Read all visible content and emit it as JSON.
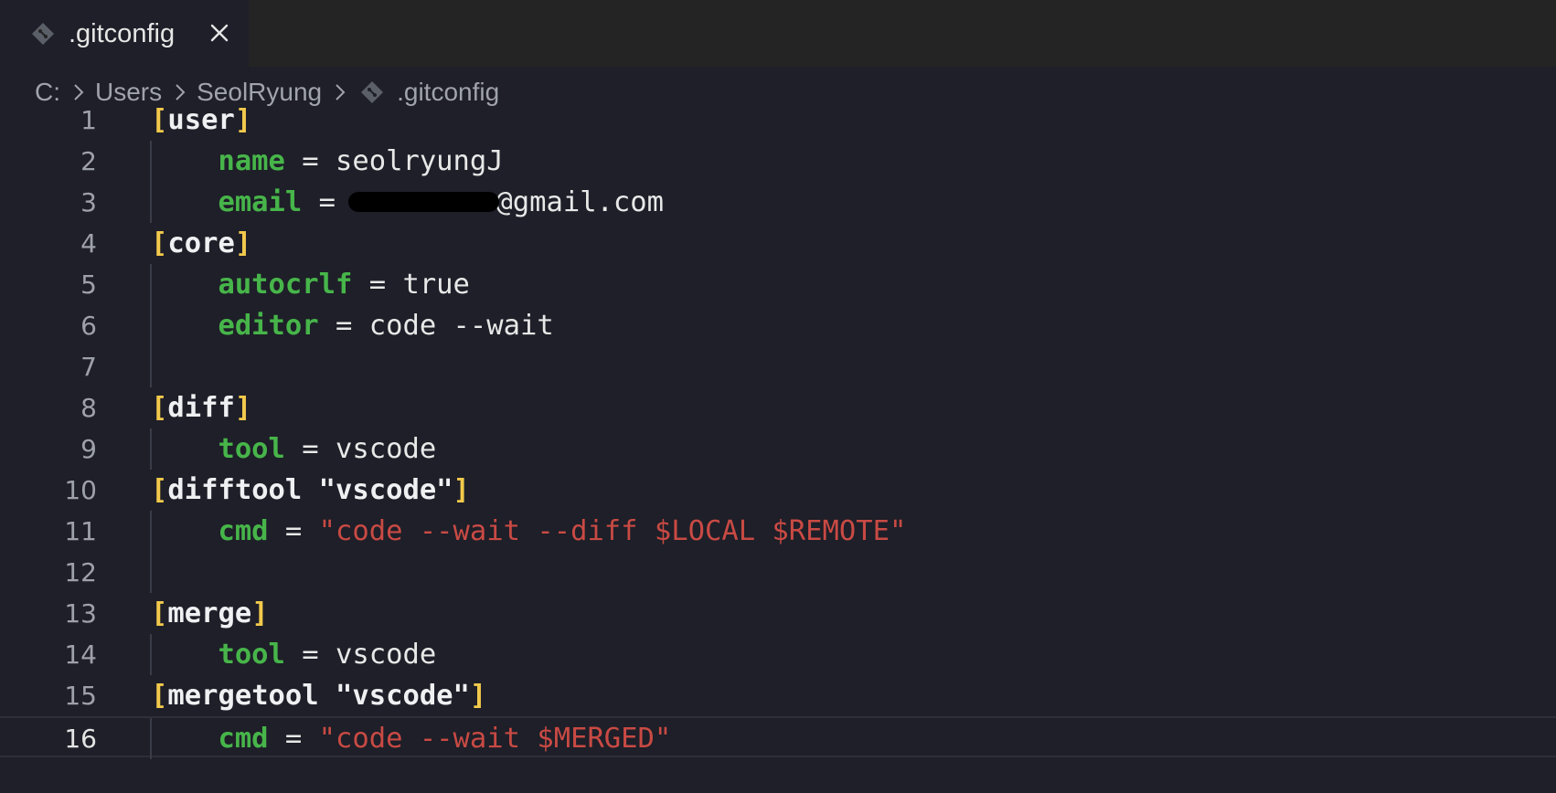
{
  "colors": {
    "background": "#1e1f28",
    "tabbar": "#242424",
    "bracket": "#f2c94c",
    "key": "#47b54a",
    "string": "#c94a44",
    "text": "#e8e8e8"
  },
  "tab": {
    "title": ".gitconfig",
    "icon": "git-file-icon",
    "close_icon": "close-icon"
  },
  "breadcrumb": {
    "items": [
      "C:",
      "Users",
      "SeolRyung",
      ".gitconfig"
    ],
    "separator_icon": "chevron-right-icon",
    "file_icon": "git-file-icon"
  },
  "editor": {
    "current_line": 16,
    "lines": [
      {
        "num": "1",
        "bracket_open": "[",
        "section": "user",
        "bracket_close": "]"
      },
      {
        "num": "2",
        "indent": "    ",
        "key": "name",
        "op": " = ",
        "value": "seolryungJ"
      },
      {
        "num": "3",
        "indent": "    ",
        "key": "email",
        "op": " = ",
        "value": "@gmail.com"
      },
      {
        "num": "4",
        "bracket_open": "[",
        "section": "core",
        "bracket_close": "]"
      },
      {
        "num": "5",
        "indent": "    ",
        "key": "autocrlf",
        "op": " = ",
        "value": "true"
      },
      {
        "num": "6",
        "indent": "    ",
        "key": "editor",
        "op": " = ",
        "value": "code --wait"
      },
      {
        "num": "7"
      },
      {
        "num": "8",
        "bracket_open": "[",
        "section": "diff",
        "bracket_close": "]"
      },
      {
        "num": "9",
        "indent": "    ",
        "key": "tool",
        "op": " = ",
        "value": "vscode"
      },
      {
        "num": "10",
        "bracket_open": "[",
        "section": "difftool \"vscode\"",
        "bracket_close": "]"
      },
      {
        "num": "11",
        "indent": "    ",
        "key": "cmd",
        "op": " = ",
        "string": "\"code --wait --diff $LOCAL $REMOTE\""
      },
      {
        "num": "12"
      },
      {
        "num": "13",
        "bracket_open": "[",
        "section": "merge",
        "bracket_close": "]"
      },
      {
        "num": "14",
        "indent": "    ",
        "key": "tool",
        "op": " = ",
        "value": "vscode"
      },
      {
        "num": "15",
        "bracket_open": "[",
        "section": "mergetool \"vscode\"",
        "bracket_close": "]"
      },
      {
        "num": "16",
        "indent": "    ",
        "key": "cmd",
        "op": " = ",
        "string": "\"code --wait $MERGED\""
      }
    ]
  }
}
